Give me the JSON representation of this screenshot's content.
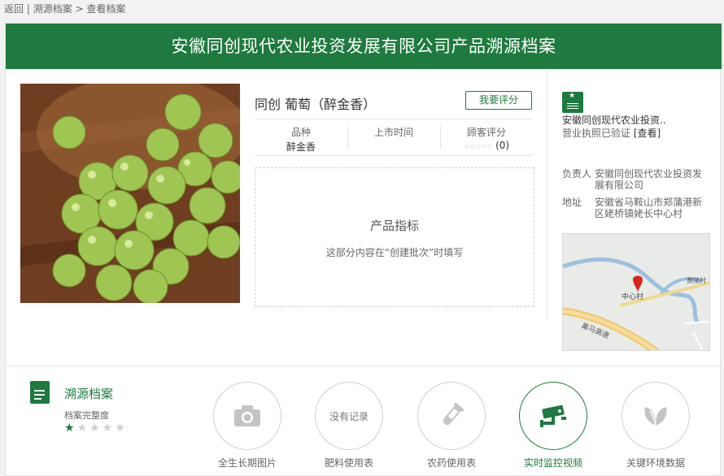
{
  "breadcrumb": {
    "back": "返回",
    "sep1": " | ",
    "archive": "溯源档案",
    "sep2": " > ",
    "current": "查看档案"
  },
  "banner": {
    "title": "安徽同创现代农业投资发展有限公司产品溯源档案"
  },
  "product": {
    "title": "同创 葡萄（醉金香）",
    "rate_button": "我要评分",
    "variety_label": "品种",
    "variety_value": "醉金香",
    "launch_label": "上市时间",
    "launch_value": "",
    "review_label": "顾客评分",
    "review_stars": "☆☆☆☆☆",
    "review_count": "(0)"
  },
  "indicator": {
    "title": "产品指标",
    "note": "这部分内容在“创建批次”时填写"
  },
  "company": {
    "name": "安徽同创现代农业投资..",
    "license_text": "营业执照已验证 ",
    "license_link": "[查看]",
    "owner_label": "负责人",
    "owner_value": "安徽同创现代农业投资发展有限公司",
    "address_label": "地址",
    "address_value": "安徽省马鞍山市郑蒲港新区姥桥镇姥长中心村"
  },
  "map": {
    "village": "中心村",
    "road": "巢马高速",
    "place": "黄陵村"
  },
  "trace": {
    "title": "溯源档案",
    "subtitle": "档案完整度",
    "rating": 1,
    "stars_on": "★",
    "stars_off": "★★★★"
  },
  "categories": [
    {
      "label": "全生长期图片",
      "icon": "camera-icon",
      "text": ""
    },
    {
      "label": "肥料使用表",
      "icon": "",
      "text": "没有记录"
    },
    {
      "label": "农药使用表",
      "icon": "test-tube-icon",
      "text": ""
    },
    {
      "label": "实时监控视频",
      "icon": "cctv-camera-icon",
      "text": "",
      "active": true
    },
    {
      "label": "关键环境数据",
      "icon": "leaf-icon",
      "text": ""
    }
  ],
  "colors": {
    "brand": "#1e7a3e",
    "border": "#e5e5e5"
  }
}
